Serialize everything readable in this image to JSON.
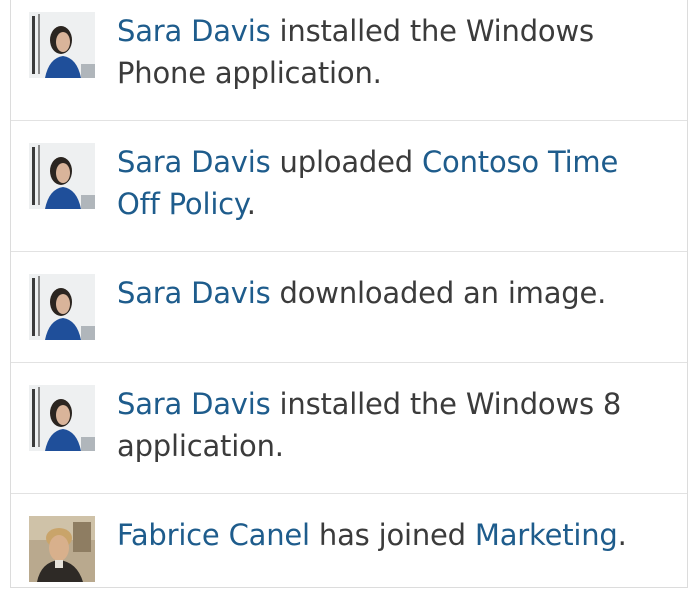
{
  "feed": {
    "items": [
      {
        "actor": "Sara Davis",
        "avatar": "sara-davis-avatar",
        "text_before": " installed the Windows Phone application.",
        "target": "",
        "text_after": ""
      },
      {
        "actor": "Sara Davis",
        "avatar": "sara-davis-avatar",
        "text_before": " uploaded ",
        "target": "Contoso Time Off Policy",
        "text_after": "."
      },
      {
        "actor": "Sara Davis",
        "avatar": "sara-davis-avatar",
        "text_before": " downloaded an image.",
        "target": "",
        "text_after": ""
      },
      {
        "actor": "Sara Davis",
        "avatar": "sara-davis-avatar",
        "text_before": " installed the Windows 8 application.",
        "target": "",
        "text_after": ""
      },
      {
        "actor": "Fabrice Canel",
        "avatar": "fabrice-canel-avatar",
        "text_before": " has joined ",
        "target": "Marketing",
        "text_after": "."
      }
    ]
  },
  "colors": {
    "link": "#1e5c8c",
    "text": "#3b3b3b",
    "divider": "#e2e2e2"
  }
}
